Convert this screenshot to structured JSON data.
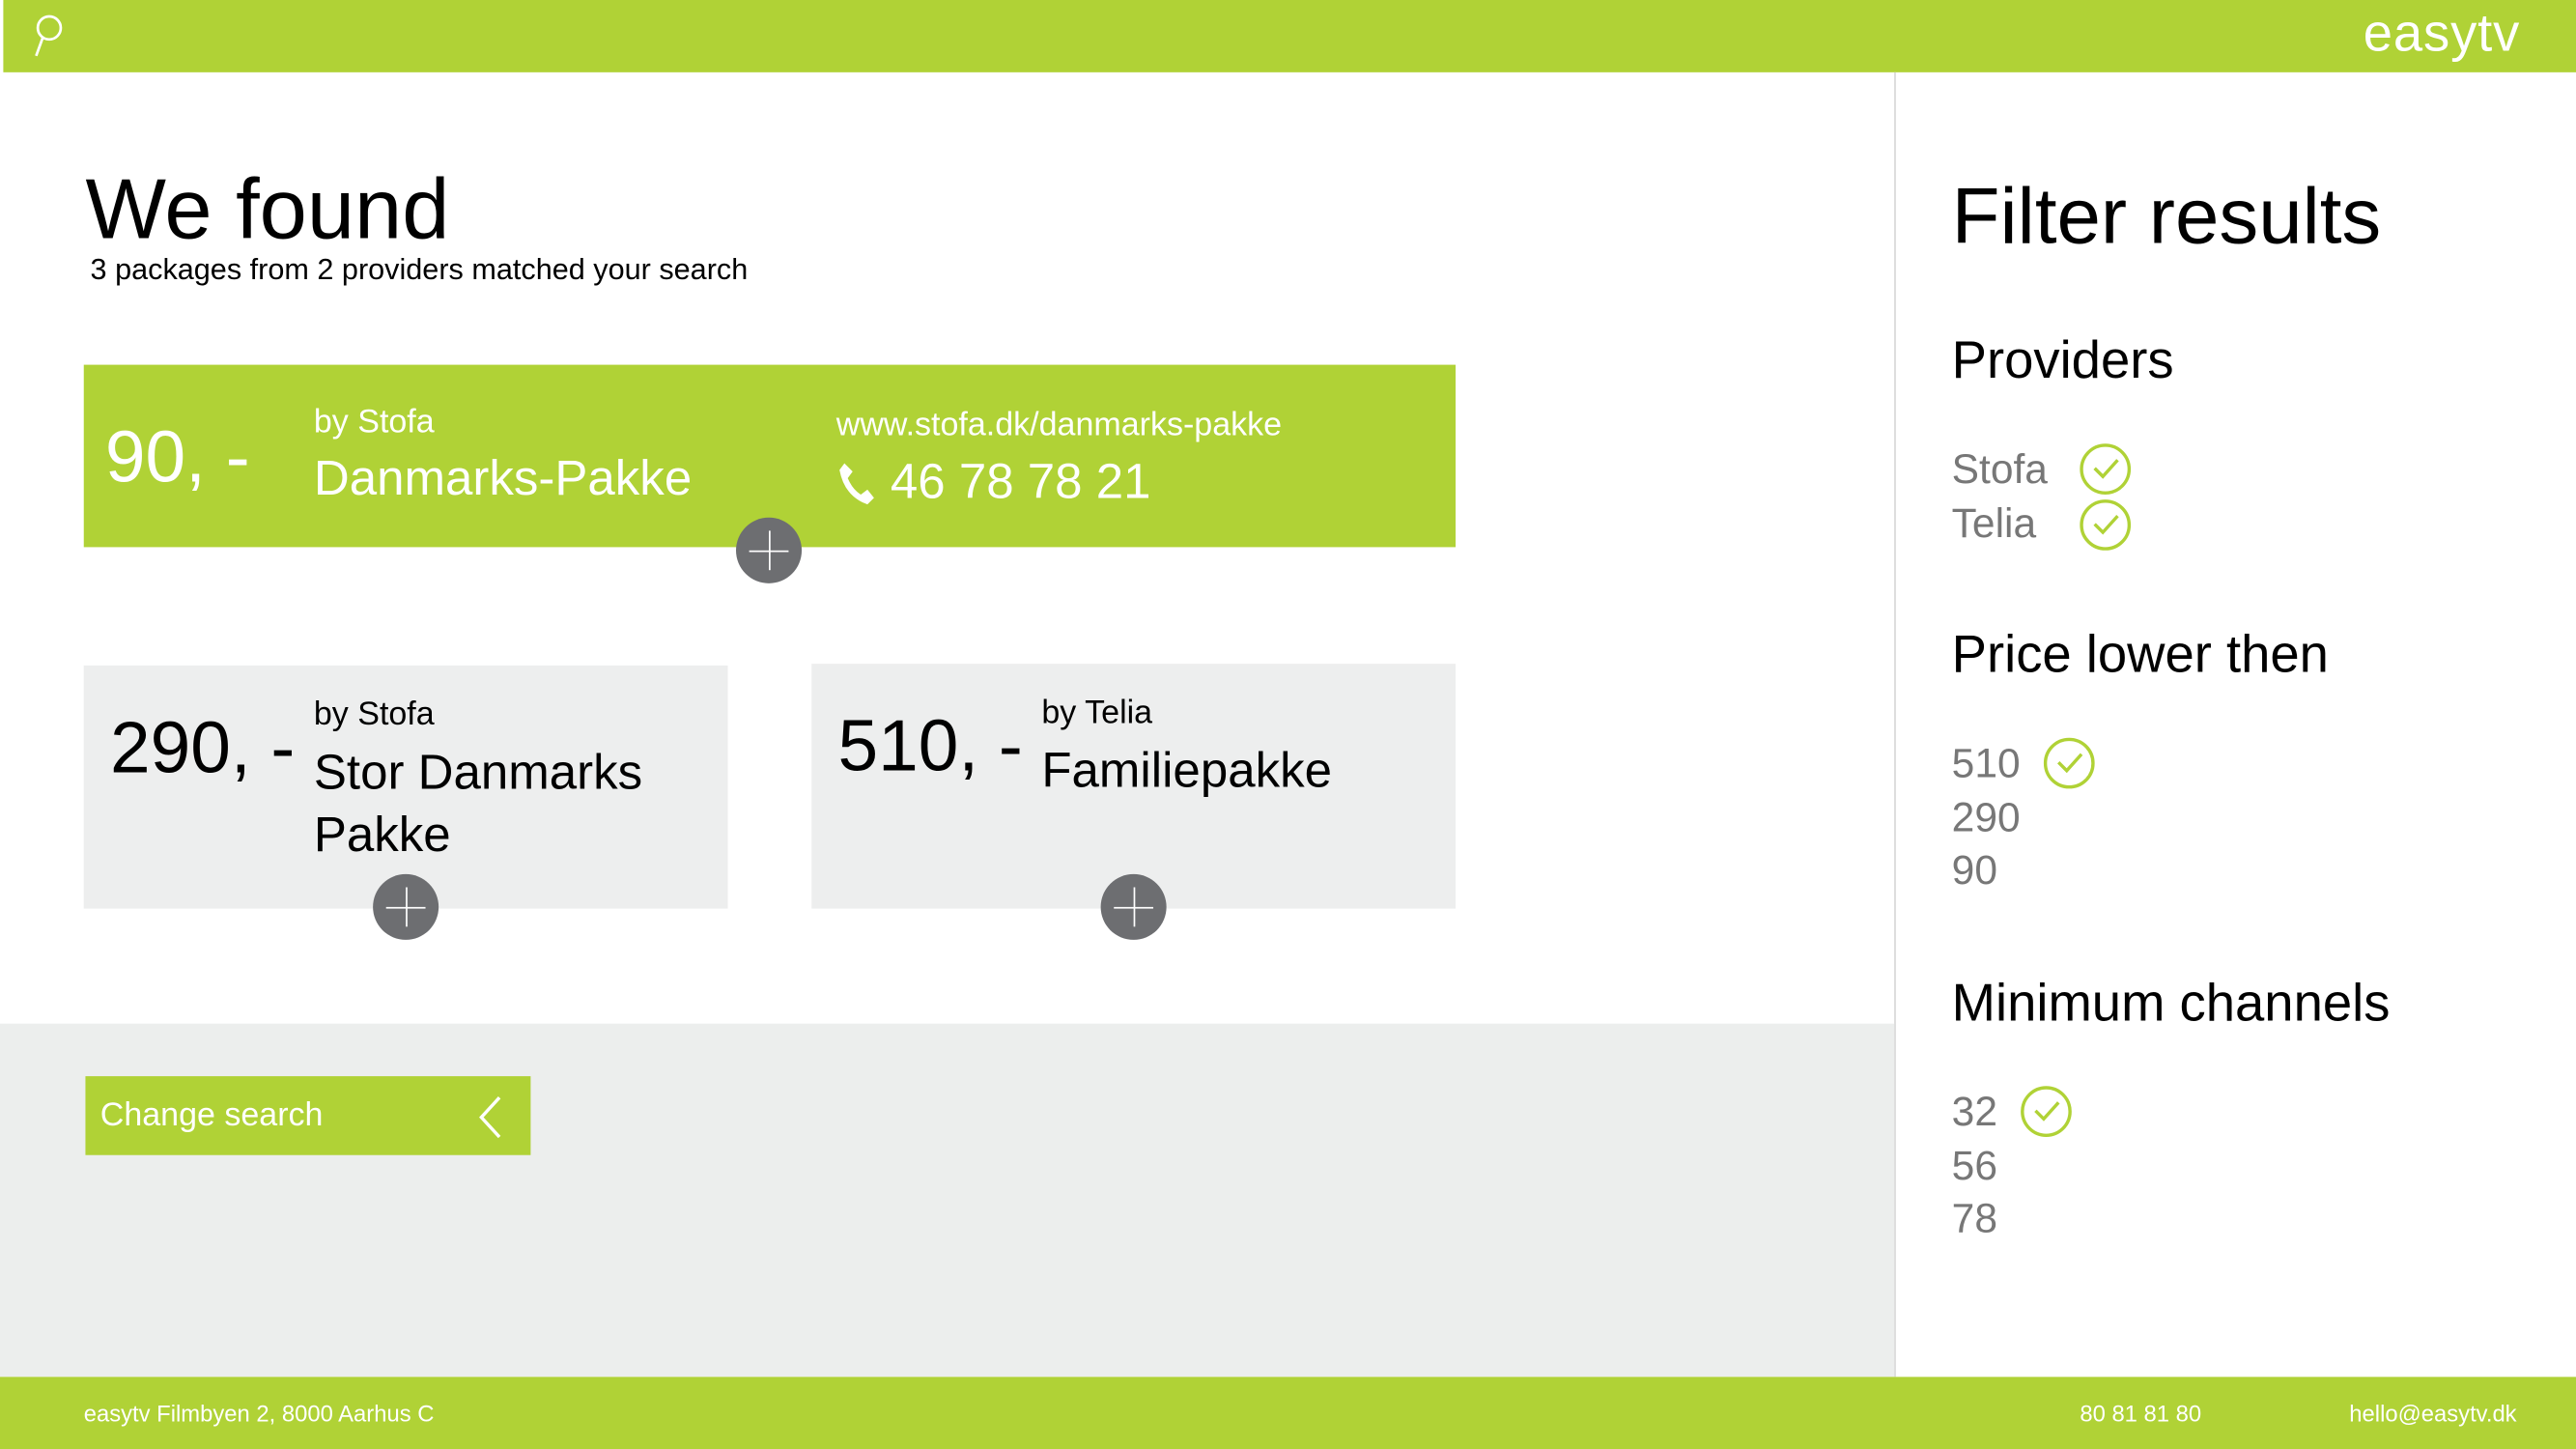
{
  "header": {
    "logo": "easytv",
    "search_icon": "search-icon"
  },
  "main": {
    "title": "We found",
    "subtitle": "3 packages from 2 providers matched your search",
    "packages": [
      {
        "price": "90, -",
        "provider": "by Stofa",
        "name": "Danmarks-Pakke",
        "url": "www.stofa.dk/danmarks-pakke",
        "phone": "46 78 78 21",
        "highlighted": true
      },
      {
        "price": "290, -",
        "provider": "by Stofa",
        "name": "Stor Danmarks Pakke",
        "highlighted": false
      },
      {
        "price": "510, -",
        "provider": "by Telia",
        "name": "Familiepakke",
        "highlighted": false
      }
    ],
    "change_search_label": "Change search"
  },
  "sidebar": {
    "title": "Filter results",
    "providers": {
      "heading": "Providers",
      "options": [
        {
          "label": "Stofa",
          "checked": true
        },
        {
          "label": "Telia",
          "checked": true
        }
      ]
    },
    "price": {
      "heading": "Price lower then",
      "options": [
        {
          "label": "510",
          "checked": true
        },
        {
          "label": "290",
          "checked": false
        },
        {
          "label": "90",
          "checked": false
        }
      ]
    },
    "channels": {
      "heading": "Minimum channels",
      "options": [
        {
          "label": "32",
          "checked": true
        },
        {
          "label": "56",
          "checked": false
        },
        {
          "label": "78",
          "checked": false
        }
      ]
    }
  },
  "footer": {
    "address": "easytv Filmbyen 2, 8000 Aarhus C",
    "phone": "80 81 81 80",
    "email": "hello@easytv.dk"
  },
  "colors": {
    "brand": "#b0d236",
    "card_gray": "#edeeee",
    "plus_gray": "#6d6e71"
  }
}
